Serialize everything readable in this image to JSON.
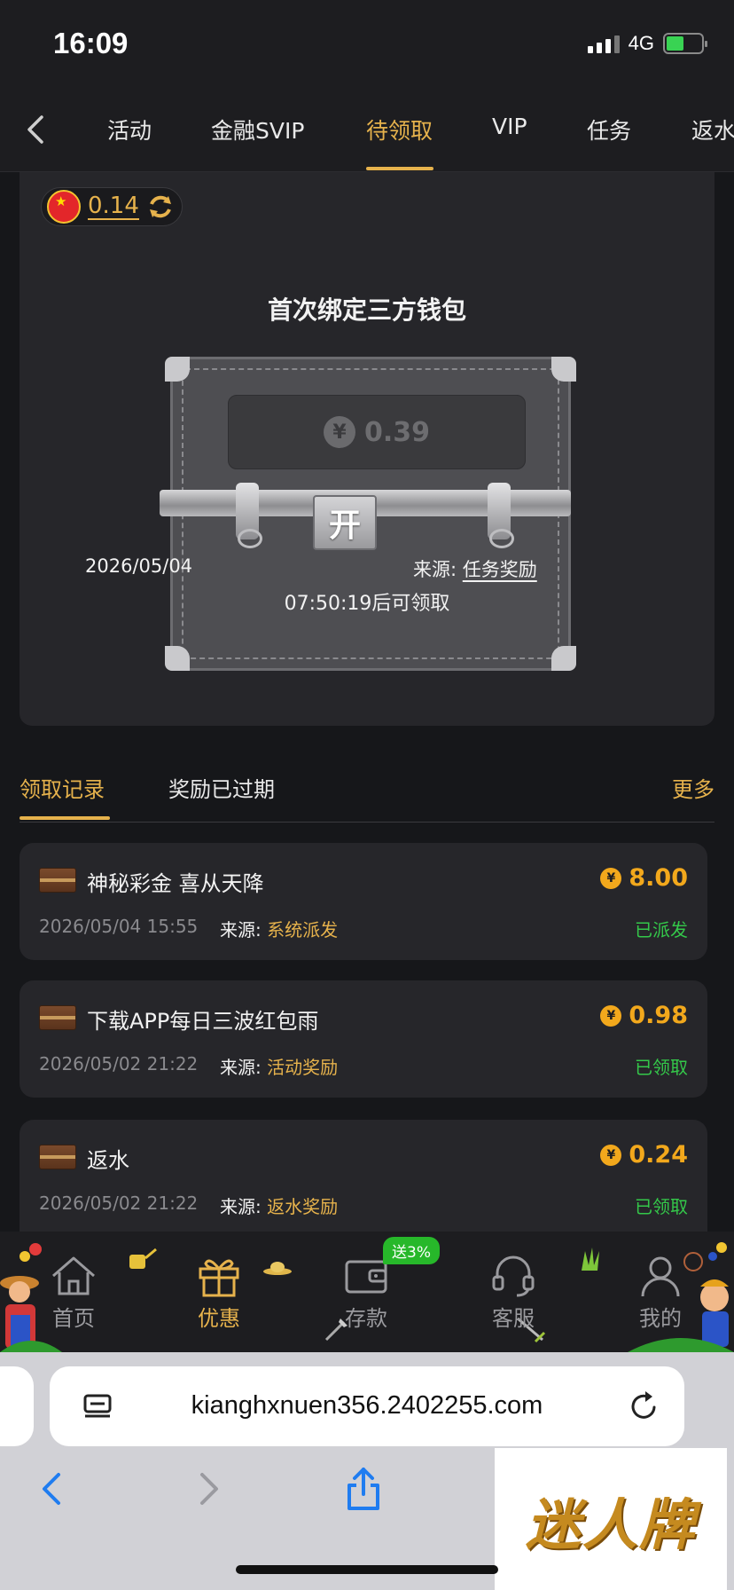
{
  "status_bar": {
    "time": "16:09",
    "network": "4G"
  },
  "top_tabs": [
    {
      "label": "活动"
    },
    {
      "label": "金融SVIP"
    },
    {
      "label": "待领取",
      "active": true
    },
    {
      "label": "VIP"
    },
    {
      "label": "任务"
    },
    {
      "label": "返水"
    }
  ],
  "card": {
    "balance": "0.14",
    "title": "首次绑定三方钱包",
    "chest_amount": "0.39",
    "chest_currency": "¥",
    "open_label": "开",
    "date": "2026/05/04",
    "source_label": "来源:",
    "source_value": "任务奖励",
    "countdown": "07:50:19后可领取"
  },
  "records": {
    "tab_received": "领取记录",
    "tab_expired": "奖励已过期",
    "more": "更多",
    "items": [
      {
        "title": "神秘彩金 喜从天降",
        "amount": "8.00",
        "date": "2026/05/04 15:55",
        "source_label": "来源:",
        "source_value": "系统派发",
        "status": "已派发"
      },
      {
        "title": "下载APP每日三波红包雨",
        "amount": "0.98",
        "date": "2026/05/02 21:22",
        "source_label": "来源:",
        "source_value": "活动奖励",
        "status": "已领取"
      },
      {
        "title": "返水",
        "amount": "0.24",
        "date": "2026/05/02 21:22",
        "source_label": "来源:",
        "source_value": "返水奖励",
        "status": "已领取"
      }
    ]
  },
  "app_nav": {
    "items": [
      {
        "label": "首页",
        "icon": "home-icon"
      },
      {
        "label": "优惠",
        "icon": "gift-icon",
        "active": true
      },
      {
        "label": "存款",
        "icon": "wallet-icon"
      },
      {
        "label": "客服",
        "icon": "headset-icon"
      },
      {
        "label": "我的",
        "icon": "user-icon"
      }
    ],
    "promo_badge": "送3%"
  },
  "browser": {
    "url": "kianghxnuen356.2402255.com",
    "brand": "迷人牌"
  },
  "colors": {
    "accent": "#e6b24c",
    "coin": "#f2a81c",
    "success": "#34c84a",
    "bg": "#16171a",
    "card": "#26262a"
  }
}
